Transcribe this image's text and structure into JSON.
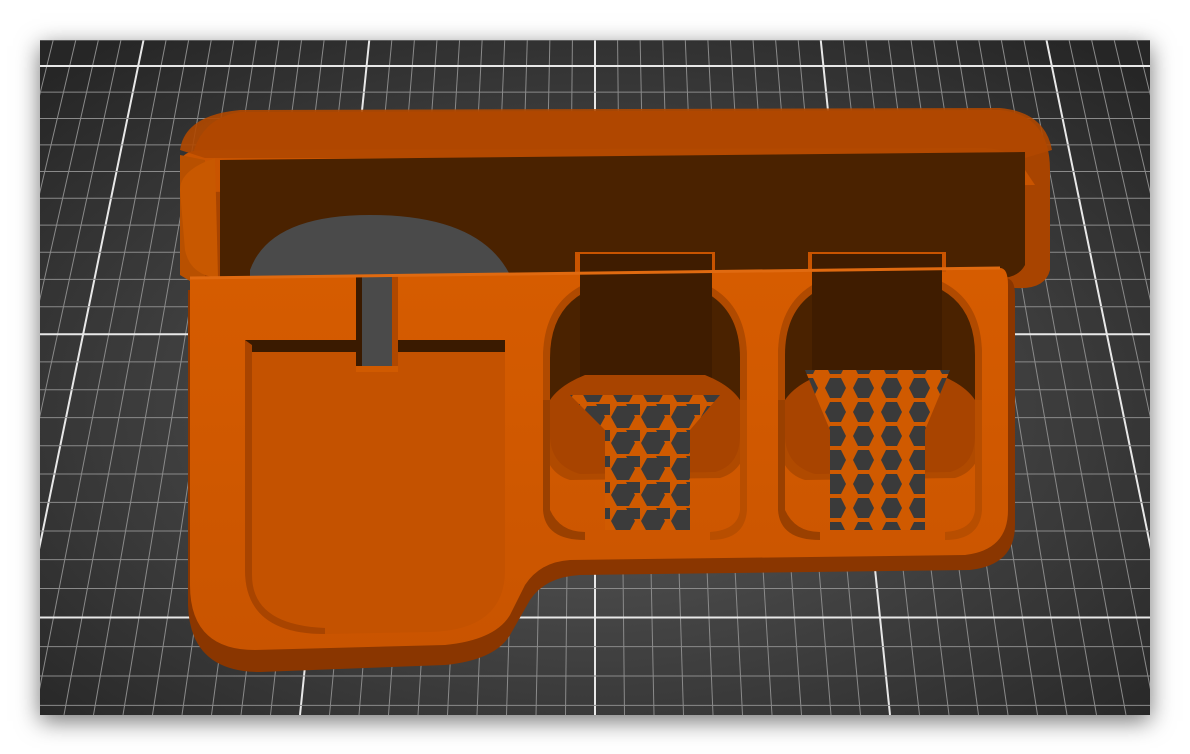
{
  "scene": {
    "description_hidden": "",
    "colors": {
      "bed_center": "#5a5a5a",
      "bed_edge": "#262626",
      "grid_minor": "#8a8a8a",
      "grid_major": "#e8e8e8",
      "model_face": "#d05a00",
      "model_side": "#a84400",
      "model_shadow": "#4a2200",
      "model_highlight": "#e06a10"
    },
    "icons": [
      "hexagon-infill-pattern"
    ]
  }
}
